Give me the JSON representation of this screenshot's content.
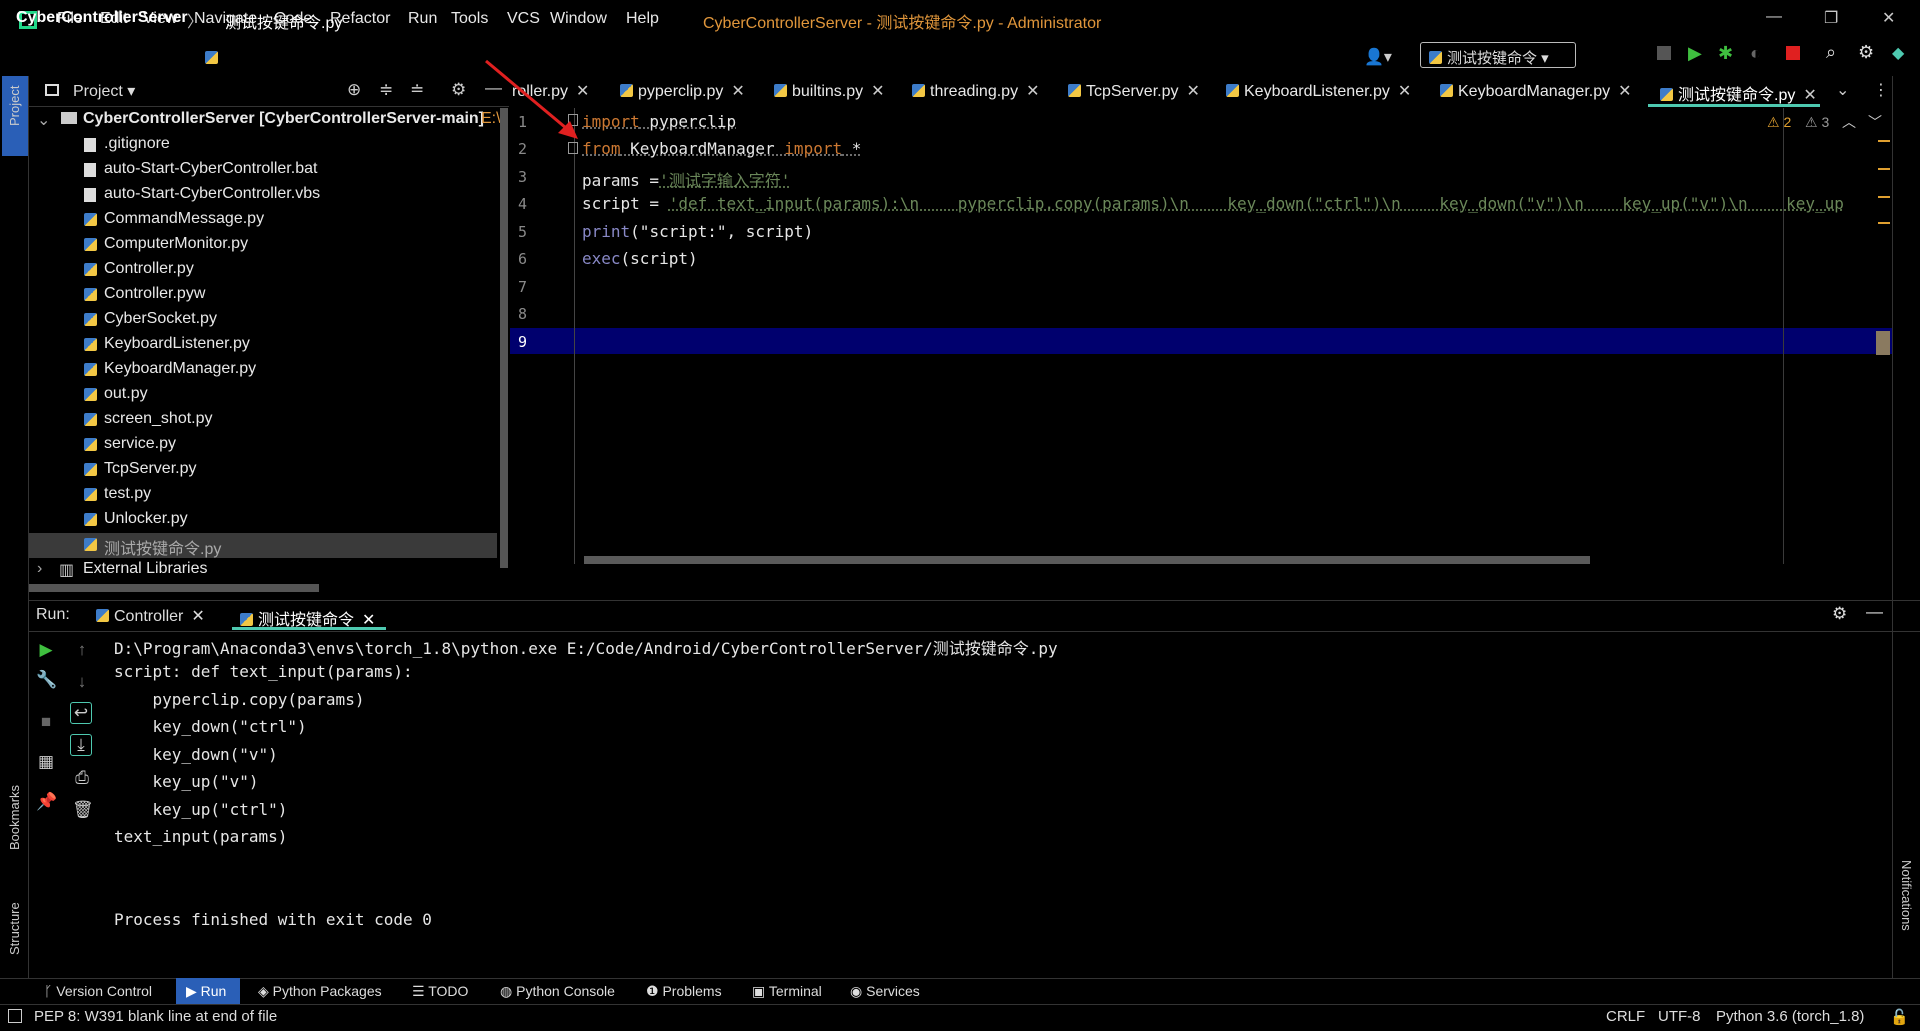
{
  "menu": [
    "File",
    "Edit",
    "View",
    "Navigate",
    "Code",
    "Refactor",
    "Run",
    "Tools",
    "VCS",
    "Window",
    "Help"
  ],
  "window_title": "CyberControllerServer - 测试按键命令.py - Administrator",
  "nav": {
    "project": "CyberControllerServer",
    "separator": "〉",
    "file": "测试按键命令.py"
  },
  "run_config": "测试按键命令 ▾",
  "project_panel": {
    "title": "Project",
    "root": "CyberControllerServer [CyberControllerServer-main]",
    "root_path": "E:\\",
    "files": [
      ".gitignore",
      "auto-Start-CyberController.bat",
      "auto-Start-CyberController.vbs",
      "CommandMessage.py",
      "ComputerMonitor.py",
      "Controller.py",
      "Controller.pyw",
      "CyberSocket.py",
      "KeyboardListener.py",
      "KeyboardManager.py",
      "out.py",
      "screen_shot.py",
      "service.py",
      "TcpServer.py",
      "test.py",
      "Unlocker.py",
      "测试按键命令.py"
    ],
    "selected": "测试按键命令.py",
    "external": "External Libraries"
  },
  "tabs": [
    "roller.py",
    "pyperclip.py",
    "builtins.py",
    "threading.py",
    "TcpServer.py",
    "KeyboardListener.py",
    "KeyboardManager.py",
    "测试按键命令.py"
  ],
  "inspections": {
    "warnings": "2",
    "weak": "3"
  },
  "code_lines": [
    "1",
    "2",
    "3",
    "4",
    "5",
    "6",
    "7",
    "8",
    "9"
  ],
  "code": {
    "l1_kw": "import",
    "l1_rest": " pyperclip",
    "l2_kw": "from",
    "l2_mod": " KeyboardManager ",
    "l2_kw2": "import",
    "l2_star": " *",
    "l3_var": "params =",
    "l3_str": "'测试字输入字符'",
    "l4_var": "script = ",
    "l4_str": "'def text_input(params):\\n    pyperclip.copy(params)\\n    key_down(\"ctrl\")\\n    key_down(\"v\")\\n    key_up(\"v\")\\n    key_up",
    "l5_fn": "print",
    "l5_rest": "(\"script:\", script)",
    "l6_fn": "exec",
    "l6_rest": "(script)"
  },
  "run_panel": {
    "label": "Run:",
    "tab1": "Controller",
    "tab2": "测试按键命令",
    "output": [
      "D:\\Program\\Anaconda3\\envs\\torch_1.8\\python.exe E:/Code/Android/CyberControllerServer/测试按键命令.py",
      "script: def text_input(params):",
      "    pyperclip.copy(params)",
      "    key_down(\"ctrl\")",
      "    key_down(\"v\")",
      "    key_up(\"v\")",
      "    key_up(\"ctrl\")",
      "text_input(params)",
      "",
      "",
      "Process finished with exit code 0"
    ]
  },
  "bottom_tools": [
    "Version Control",
    "Run",
    "Python Packages",
    "TODO",
    "Python Console",
    "Problems",
    "Terminal",
    "Services"
  ],
  "status": {
    "message": "PEP 8: W391 blank line at end of file",
    "line_sep": "CRLF",
    "encoding": "UTF-8",
    "interpreter": "Python 3.6 (torch_1.8)"
  },
  "side_labels": {
    "project": "Project",
    "bookmarks": "Bookmarks",
    "structure": "Structure",
    "notifications": "Notifications"
  }
}
